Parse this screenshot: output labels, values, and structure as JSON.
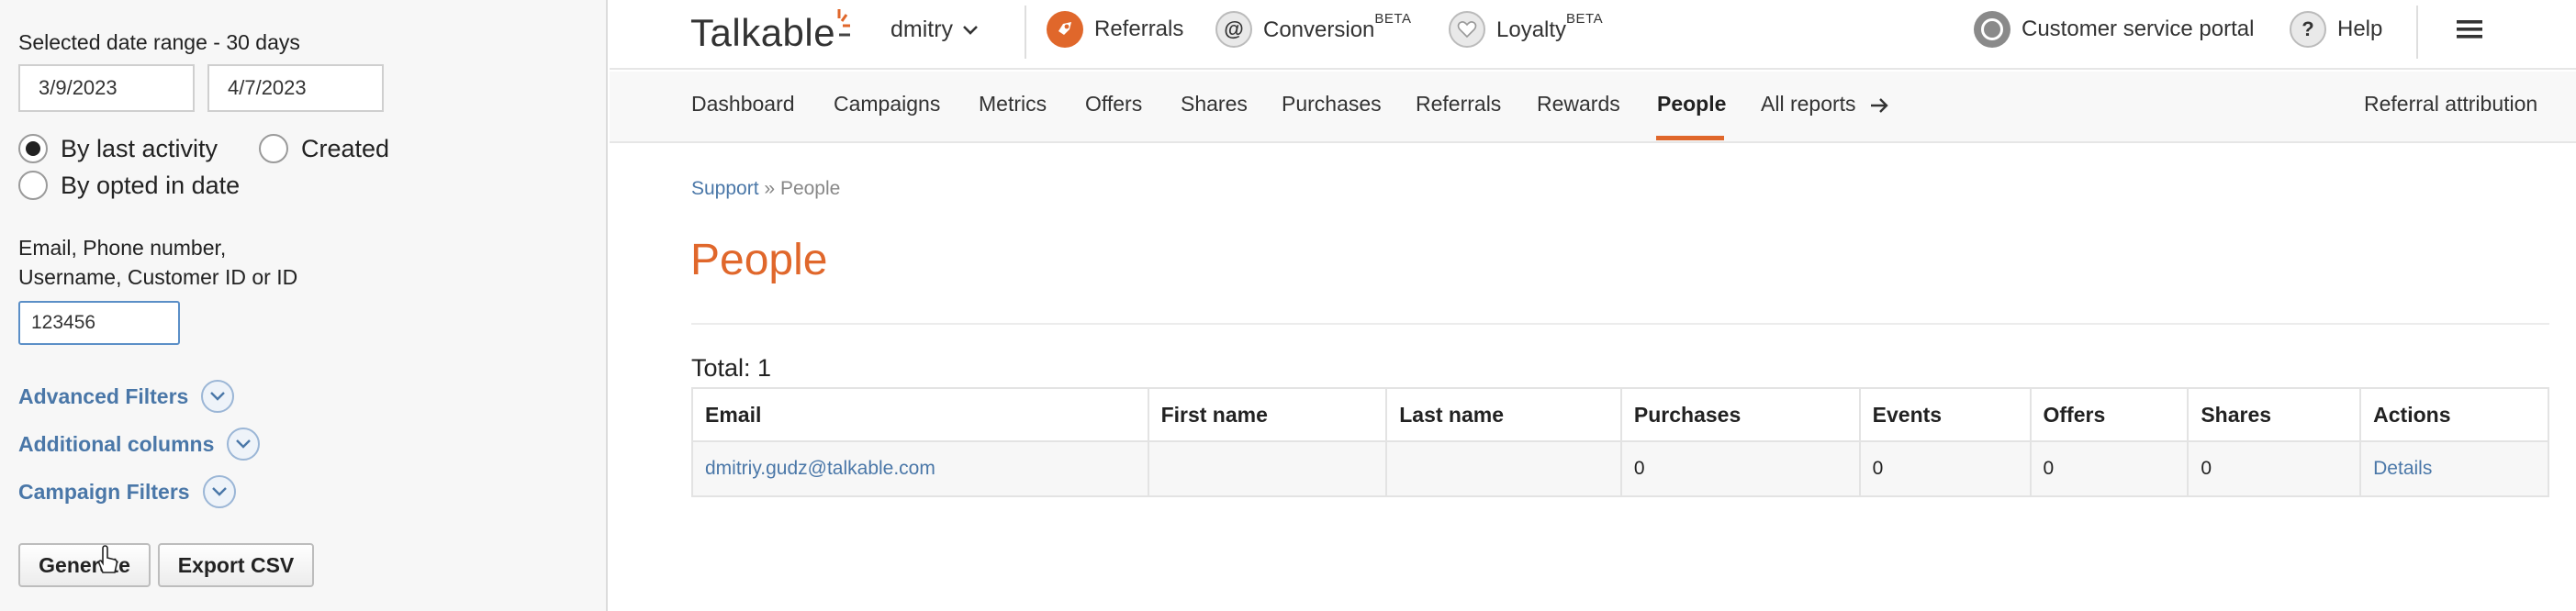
{
  "sidebar": {
    "date_range_label": "Selected date range - 30 days",
    "date_from": "3/9/2023",
    "date_to": "4/7/2023",
    "radio_options": [
      {
        "label": "By last activity",
        "checked": true
      },
      {
        "label": "Created",
        "checked": false
      },
      {
        "label": "By opted in date",
        "checked": false
      }
    ],
    "search_label_line1": "Email, Phone number,",
    "search_label_line2": "Username, Customer ID or ID",
    "search_value": "123456",
    "filters": [
      "Advanced Filters",
      "Additional columns",
      "Campaign Filters"
    ],
    "generate_label": "Generate",
    "export_label": "Export CSV"
  },
  "topbar": {
    "logo": "Talkable",
    "account": "dmitry",
    "products": [
      {
        "label": "Referrals",
        "badge": ""
      },
      {
        "label": "Conversion",
        "badge": "BETA"
      },
      {
        "label": "Loyalty",
        "badge": "BETA"
      }
    ],
    "support_portal": "Customer service portal",
    "help": "Help"
  },
  "nav": {
    "items": [
      "Dashboard",
      "Campaigns",
      "Metrics",
      "Offers",
      "Shares",
      "Purchases",
      "Referrals",
      "Rewards",
      "People",
      "All reports"
    ],
    "active": "People",
    "right_link": "Referral attribution"
  },
  "content": {
    "breadcrumb_root": "Support",
    "breadcrumb_sep": "»",
    "breadcrumb_current": "People",
    "title": "People",
    "total": "Total: 1",
    "table": {
      "headers": [
        "Email",
        "First name",
        "Last name",
        "Purchases",
        "Events",
        "Offers",
        "Shares",
        "Actions"
      ],
      "rows": [
        [
          "dmitriy.gudz@talkable.com",
          "",
          "",
          "0",
          "0",
          "0",
          "0",
          "Details"
        ]
      ]
    }
  },
  "colors": {
    "accent": "#e0672b",
    "link": "#4a77a8"
  }
}
